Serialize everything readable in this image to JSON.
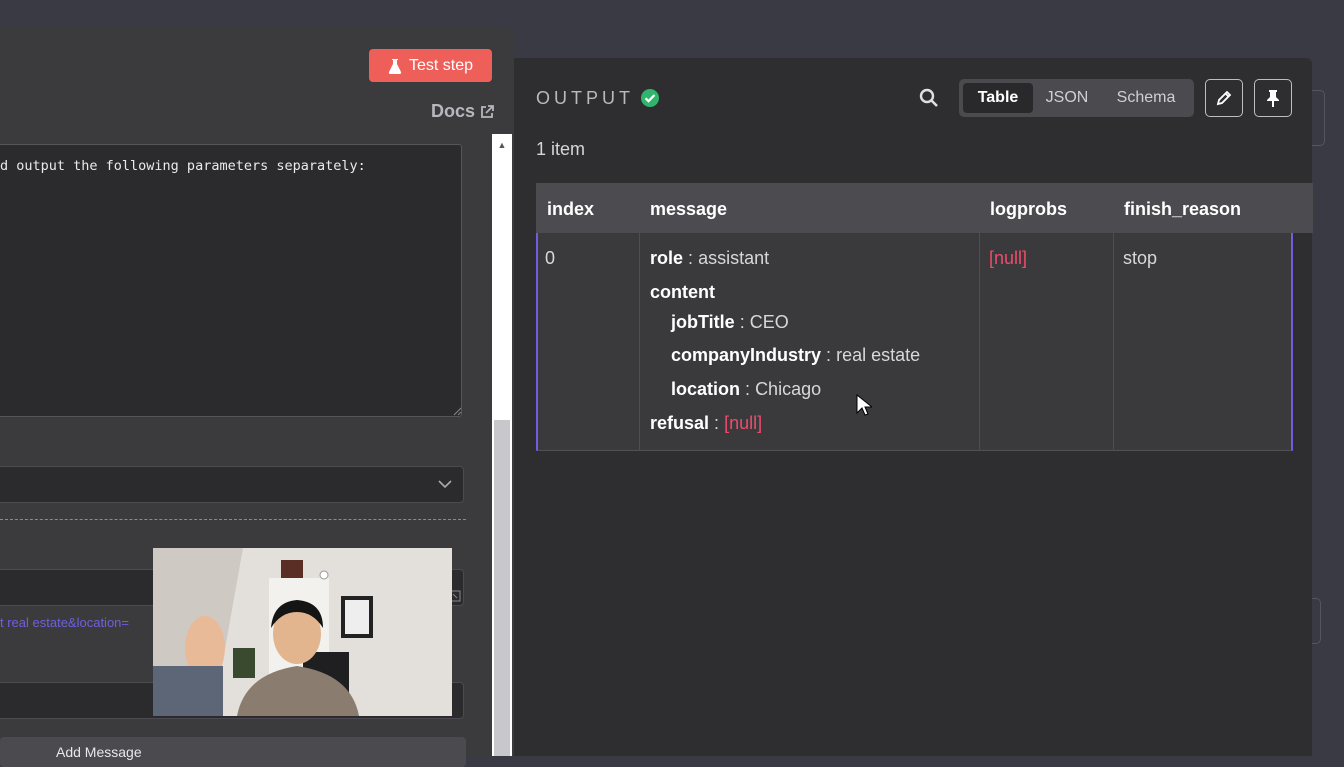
{
  "left_panel": {
    "test_step_label": "Test step",
    "docs_label": "Docs",
    "prompt_text": "d output the following parameters separately:",
    "expression_text": "t real estate&location=",
    "add_message_label": "Add Message"
  },
  "output": {
    "title": "OUTPUT",
    "item_count": "1 item",
    "view_tabs": [
      "Table",
      "JSON",
      "Schema"
    ],
    "active_tab": "Table",
    "columns": [
      "index",
      "message",
      "logprobs",
      "finish_reason"
    ],
    "row": {
      "index": "0",
      "role_key": "role",
      "role_value": "assistant",
      "content_key": "content",
      "job_title_key": "jobTitle",
      "job_title_value": "CEO",
      "company_industry_key": "companyIndustry",
      "company_industry_value": "real estate",
      "location_key": "location",
      "location_value": "Chicago",
      "refusal_key": "refusal",
      "refusal_value": "[null]",
      "logprobs": "[null]",
      "finish_reason": "stop"
    },
    "separator": ":"
  },
  "colors": {
    "accent_red": "#ef5f5a",
    "success_green": "#2fb66c",
    "null_pink": "#ef4b6c",
    "row_highlight": "#6f5fe0"
  }
}
